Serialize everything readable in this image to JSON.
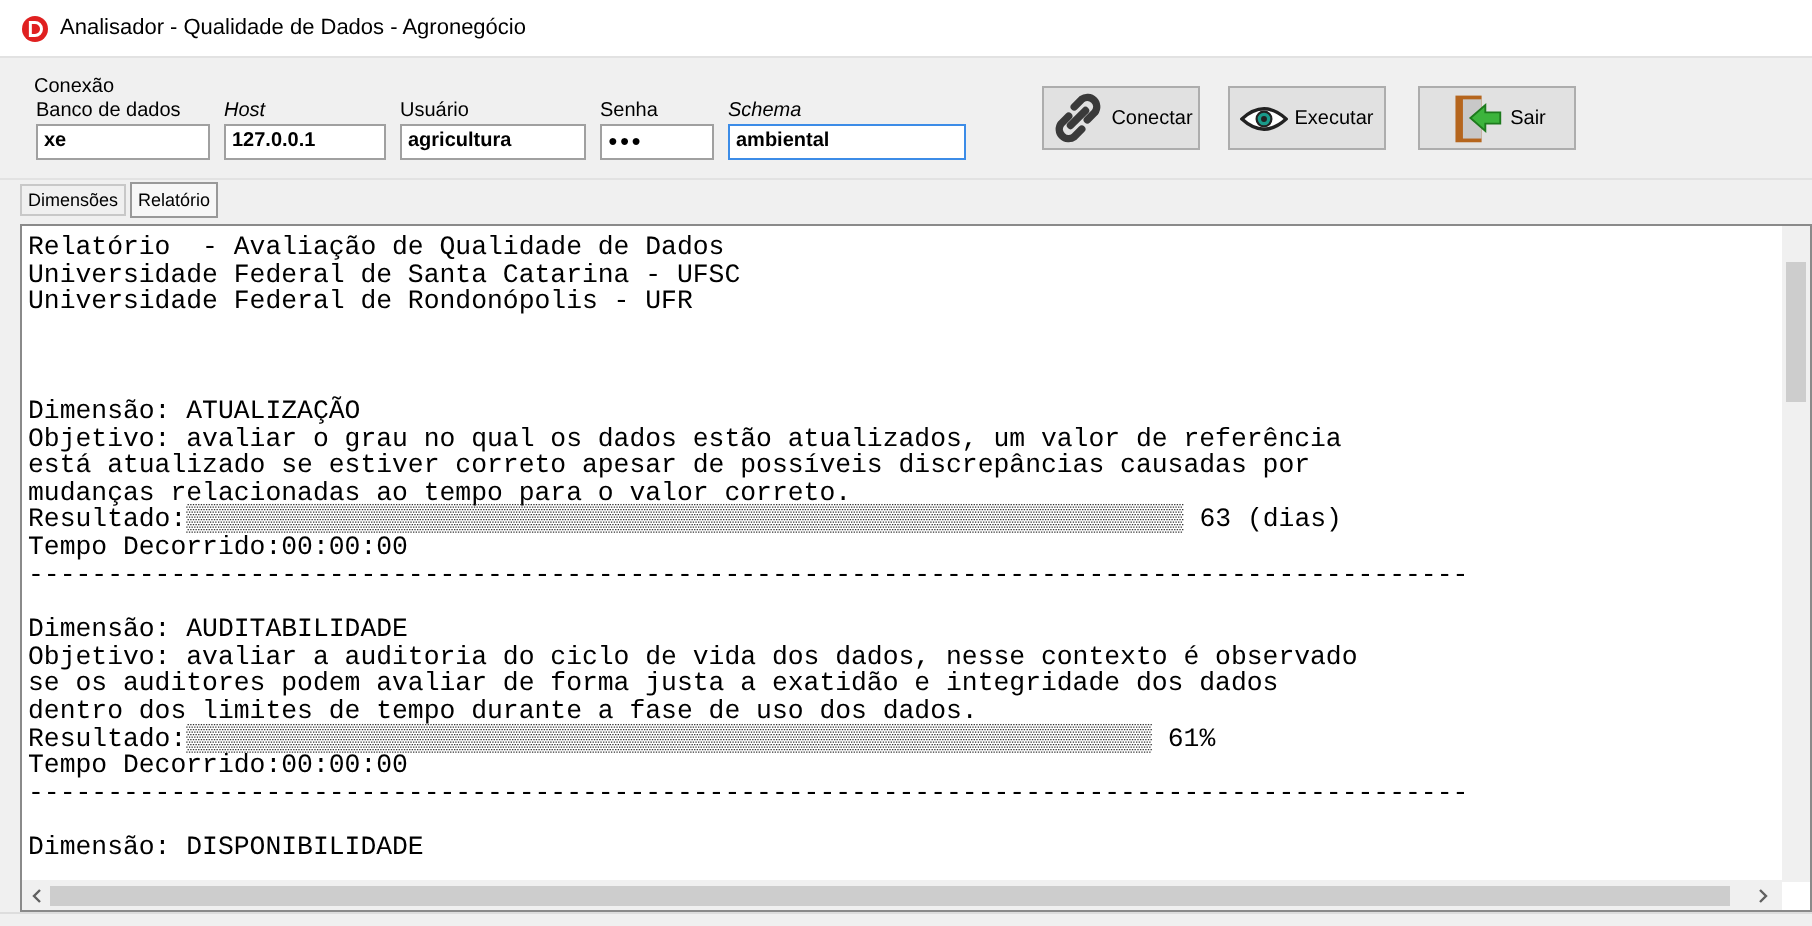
{
  "window": {
    "title": "Analisador - Qualidade de Dados - Agronegócio"
  },
  "connection": {
    "legend": "Conexão",
    "fields": [
      {
        "label": "Banco de dados",
        "italic": false,
        "value": "xe",
        "focused": false,
        "kind": "text"
      },
      {
        "label": "Host",
        "italic": true,
        "value": "127.0.0.1",
        "focused": false,
        "kind": "text"
      },
      {
        "label": "Usuário",
        "italic": false,
        "value": "agricultura",
        "focused": false,
        "kind": "text"
      },
      {
        "label": "Senha",
        "italic": false,
        "value": "●●●",
        "focused": false,
        "kind": "password"
      },
      {
        "label": "Schema",
        "italic": true,
        "value": "ambiental",
        "focused": true,
        "kind": "text"
      }
    ],
    "buttons": [
      {
        "label": "Conectar",
        "kind": "connect"
      },
      {
        "label": "Executar",
        "kind": "execute"
      },
      {
        "label": "Sair",
        "kind": "exit"
      }
    ]
  },
  "tabs": [
    {
      "label": "Dimensões",
      "selected": false
    },
    {
      "label": "Relatório",
      "selected": true
    }
  ],
  "report": {
    "header": [
      "Relatório  - Avaliação de Qualidade de Dados",
      "Universidade Federal de Santa Catarina - UFSC",
      "Universidade Federal de Rondonópolis - UFR"
    ],
    "sections": [
      {
        "title": "Dimensão: ATUALIZAÇÃO",
        "objective": [
          "Objetivo: avaliar o grau no qual os dados estão atualizados, um valor de referência",
          "está atualizado se estiver correto apesar de possíveis discrepâncias causadas por",
          "mudanças relacionadas ao tempo para o valor correto."
        ],
        "result_label": "Resultado:",
        "result_bar": "▒▒▒▒▒▒▒▒▒▒▒▒▒▒▒▒▒▒▒▒▒▒▒▒▒▒▒▒▒▒▒▒▒▒▒▒▒▒▒▒▒▒▒▒▒▒▒▒▒▒▒▒▒▒▒▒▒▒▒▒▒▒▒",
        "result_value": "63 (dias)",
        "elapsed": "Tempo Decorrido:00:00:00",
        "separator": "-------------------------------------------------------------------------------------------"
      },
      {
        "title": "Dimensão: AUDITABILIDADE",
        "objective": [
          "Objetivo: avaliar a auditoria do ciclo de vida dos dados, nesse contexto é observado",
          "se os auditores podem avaliar de forma justa a exatidão e integridade dos dados",
          "dentro dos limites de tempo durante a fase de uso dos dados."
        ],
        "result_label": "Resultado:",
        "result_bar": "▒▒▒▒▒▒▒▒▒▒▒▒▒▒▒▒▒▒▒▒▒▒▒▒▒▒▒▒▒▒▒▒▒▒▒▒▒▒▒▒▒▒▒▒▒▒▒▒▒▒▒▒▒▒▒▒▒▒▒▒▒",
        "result_value": "61%",
        "elapsed": "Tempo Decorrido:00:00:00",
        "separator": "-------------------------------------------------------------------------------------------"
      },
      {
        "title": "Dimensão: DISPONIBILIDADE"
      }
    ]
  }
}
